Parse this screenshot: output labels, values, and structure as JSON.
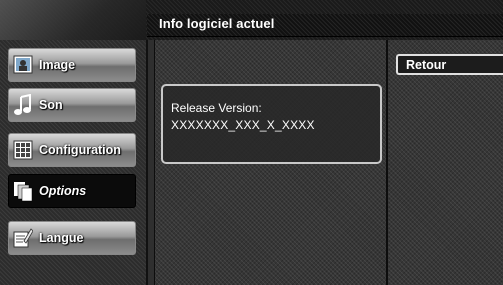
{
  "header": {
    "title": "Info logiciel actuel"
  },
  "menu": {
    "items": [
      {
        "label": "Image",
        "icon": "image-icon",
        "selected": false
      },
      {
        "label": "Son",
        "icon": "music-note-icon",
        "selected": false
      },
      {
        "label": "Configuration",
        "icon": "grid-icon",
        "selected": false
      },
      {
        "label": "Options",
        "icon": "options-icon",
        "selected": true
      },
      {
        "label": "Langue",
        "icon": "language-icon",
        "selected": false
      }
    ]
  },
  "info": {
    "label": "Release Version:",
    "value": "XXXXXXX_XXX_X_XXXX"
  },
  "actions": {
    "back_label": "Retour"
  }
}
